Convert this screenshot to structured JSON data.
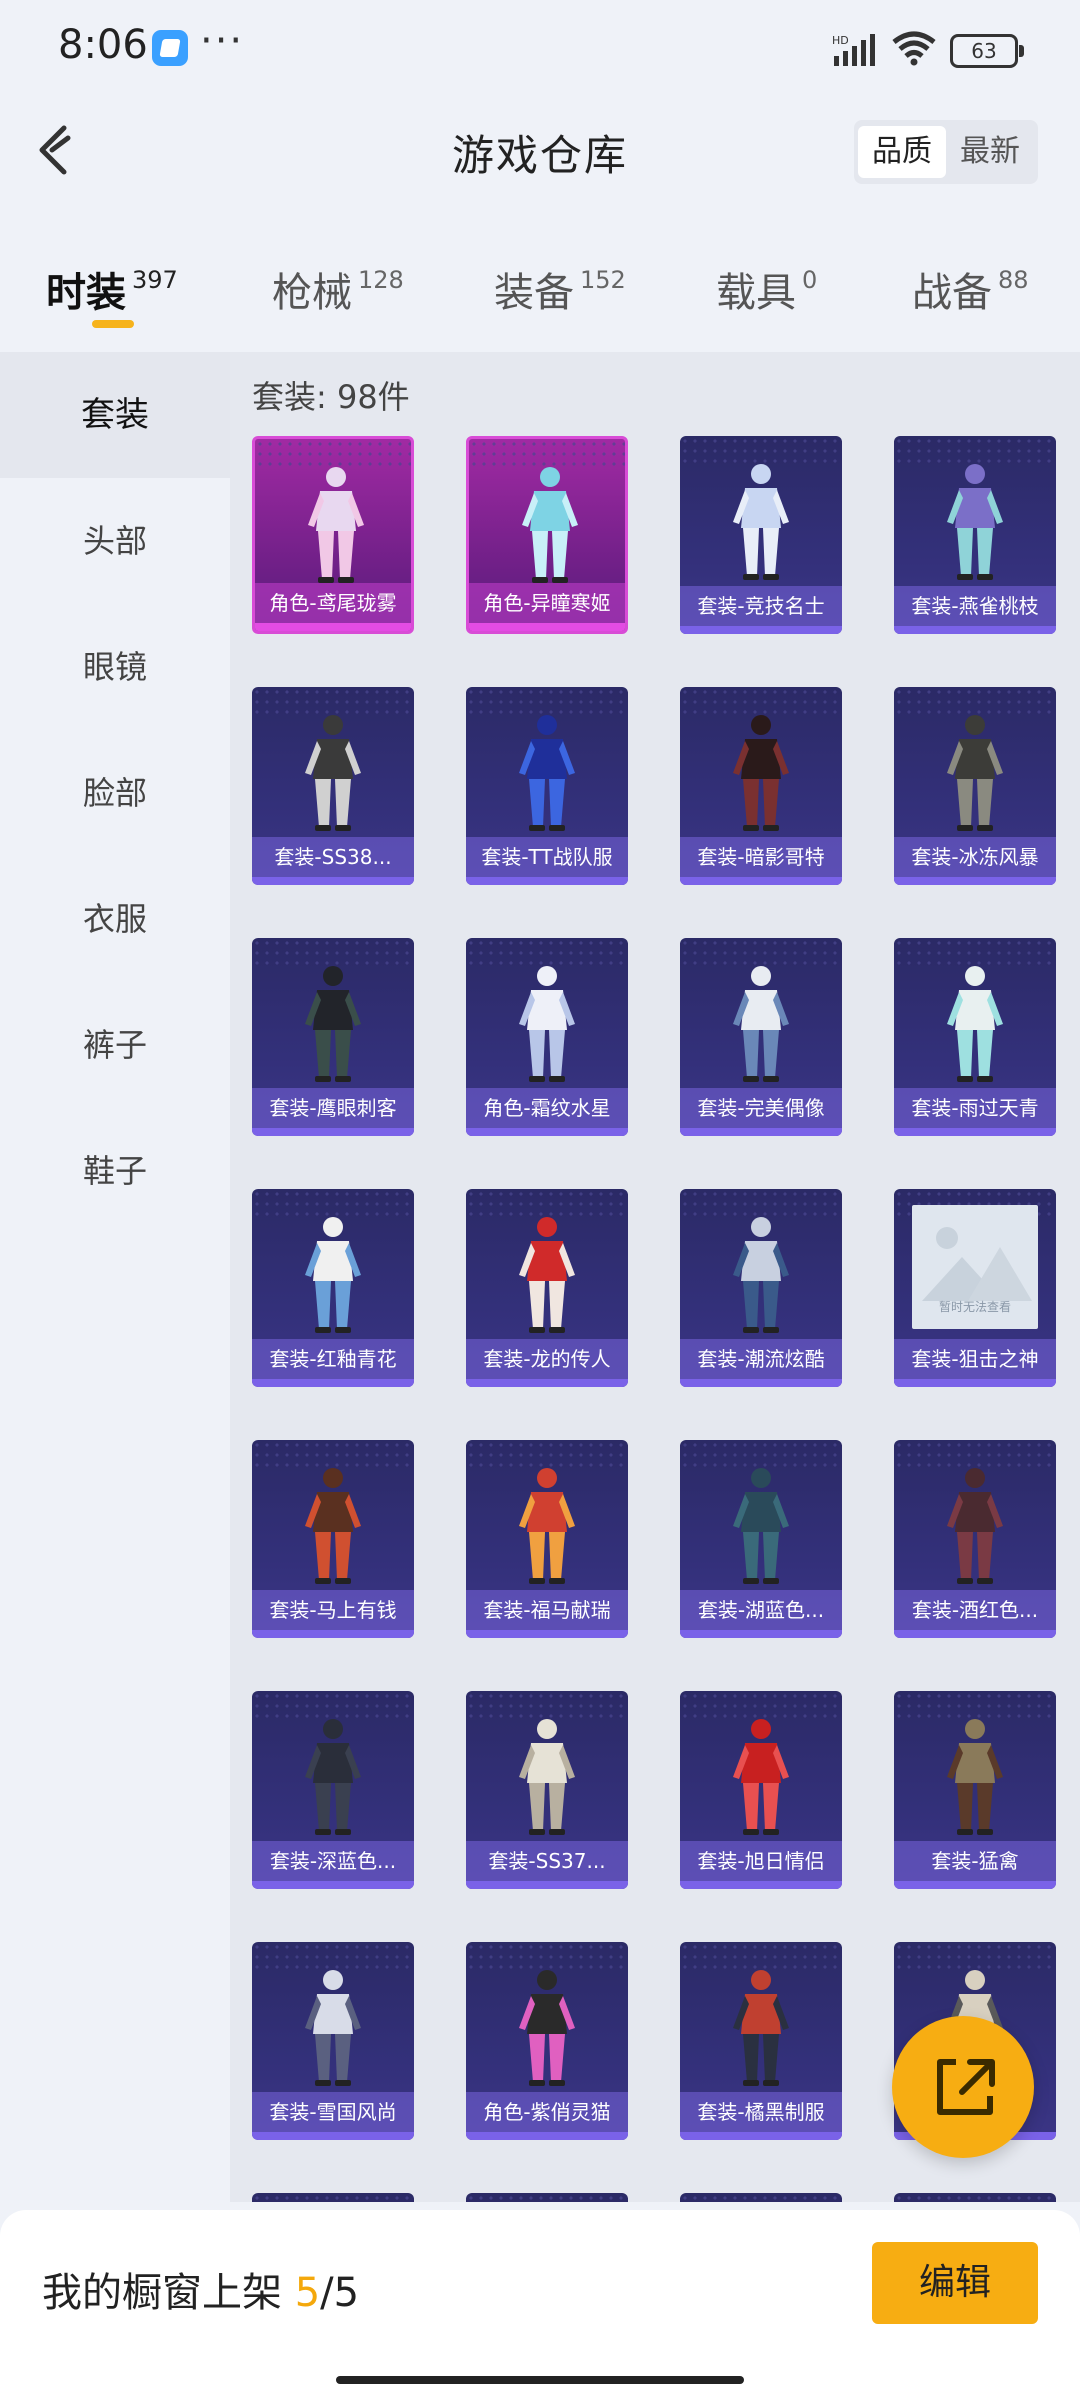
{
  "status_bar": {
    "time": "8:06",
    "battery": "63",
    "network": "HD"
  },
  "header": {
    "title": "游戏仓库",
    "sort_options": [
      "品质",
      "最新"
    ],
    "active_sort": "品质"
  },
  "tabs": [
    {
      "label": "时装",
      "count": "397"
    },
    {
      "label": "枪械",
      "count": "128"
    },
    {
      "label": "装备",
      "count": "152"
    },
    {
      "label": "载具",
      "count": "0"
    },
    {
      "label": "战备",
      "count": "88"
    }
  ],
  "sidebar": {
    "items": [
      "套装",
      "头部",
      "眼镜",
      "脸部",
      "衣服",
      "裤子",
      "鞋子"
    ],
    "active": "套装"
  },
  "content": {
    "count_label": "套装: 98件"
  },
  "items": [
    {
      "label": "角色-鸢尾珑雾",
      "rarity": "purple",
      "icon": "pink-dress-character"
    },
    {
      "label": "角色-异瞳寒姬",
      "rarity": "purple",
      "icon": "cyan-outfit-character"
    },
    {
      "label": "套装-竞技名士",
      "rarity": "blue",
      "icon": "jacket-pants-outfit"
    },
    {
      "label": "套装-燕雀桃枝",
      "rarity": "blue",
      "icon": "twin-hanfu-outfit"
    },
    {
      "label": "套装-SS38...",
      "rarity": "blue",
      "icon": "casual-outfit"
    },
    {
      "label": "套装-TT战队服",
      "rarity": "blue",
      "icon": "team-suit-character"
    },
    {
      "label": "套装-暗影哥特",
      "rarity": "blue",
      "icon": "gothic-outfit"
    },
    {
      "label": "套装-冰冻风暴",
      "rarity": "blue",
      "icon": "armor-outfit"
    },
    {
      "label": "套装-鹰眼刺客",
      "rarity": "blue",
      "icon": "assassin-outfit"
    },
    {
      "label": "角色-霜纹水星",
      "rarity": "blue",
      "icon": "white-gown-character"
    },
    {
      "label": "套装-完美偶像",
      "rarity": "blue",
      "icon": "idol-outfit"
    },
    {
      "label": "套装-雨过天青",
      "rarity": "blue",
      "icon": "couple-outfit"
    },
    {
      "label": "套装-红釉青花",
      "rarity": "blue",
      "icon": "porcelain-couple-outfit"
    },
    {
      "label": "套装-龙的传人",
      "rarity": "blue",
      "icon": "dragon-couple-outfit"
    },
    {
      "label": "套装-潮流炫酷",
      "rarity": "blue",
      "icon": "street-outfit"
    },
    {
      "label": "套装-狙击之神",
      "rarity": "blue",
      "icon": "image-unavailable",
      "placeholder": true
    },
    {
      "label": "套装-马上有钱",
      "rarity": "blue",
      "icon": "horse-mask-character"
    },
    {
      "label": "套装-福马献瑞",
      "rarity": "blue",
      "icon": "festive-couple-outfit"
    },
    {
      "label": "套装-湖蓝色...",
      "rarity": "blue",
      "icon": "blue-suit-outfit"
    },
    {
      "label": "套装-酒红色...",
      "rarity": "blue",
      "icon": "wine-suit-outfit"
    },
    {
      "label": "套装-深蓝色...",
      "rarity": "blue",
      "icon": "navy-suit-outfit"
    },
    {
      "label": "套装-SS37...",
      "rarity": "blue",
      "icon": "white-casual-outfit"
    },
    {
      "label": "套装-旭日情侣",
      "rarity": "blue",
      "icon": "red-hoodie-outfit"
    },
    {
      "label": "套装-猛禽",
      "rarity": "blue",
      "icon": "hunter-outfit"
    },
    {
      "label": "套装-雪国风尚",
      "rarity": "blue",
      "icon": "snow-couple-outfit"
    },
    {
      "label": "角色-紫俏灵猫",
      "rarity": "blue",
      "icon": "cat-girl-character"
    },
    {
      "label": "套装-橘黑制服",
      "rarity": "blue",
      "icon": "uniform-outfit"
    },
    {
      "label": "",
      "rarity": "blue",
      "icon": "fur-coat-outfit"
    }
  ],
  "bottom_bar": {
    "shelf_label": "我的橱窗上架",
    "shelf_current": "5",
    "shelf_total": "/5",
    "edit_label": "编辑"
  },
  "colors": {
    "accent": "#f7ad12",
    "card_bg": "#2f2c70",
    "card_purple": "#a12aa3"
  }
}
